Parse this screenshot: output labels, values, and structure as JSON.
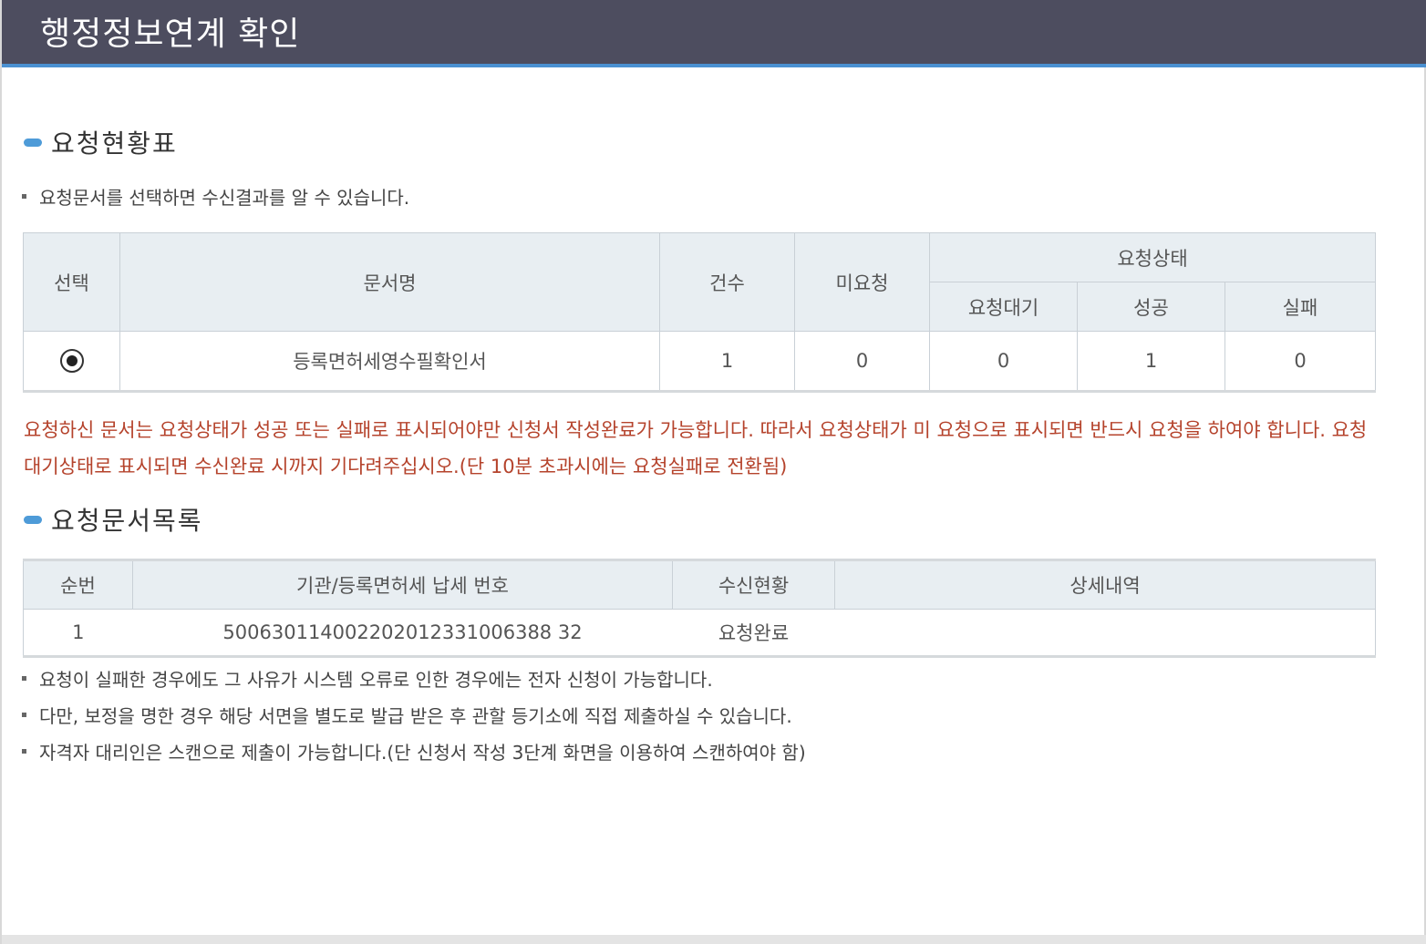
{
  "window": {
    "title": "행정정보연계 확인"
  },
  "section1": {
    "title": "요청현황표",
    "hint": "요청문서를 선택하면 수신결과를 알 수 있습니다.",
    "table": {
      "headers": {
        "select": "선택",
        "doc_name": "문서명",
        "count": "건수",
        "unrequested": "미요청",
        "status_group": "요청상태",
        "waiting": "요청대기",
        "success": "성공",
        "fail": "실패"
      },
      "row": {
        "selected": true,
        "doc_name": "등록면허세영수필확인서",
        "count": "1",
        "unrequested": "0",
        "waiting": "0",
        "success": "1",
        "fail": "0"
      }
    },
    "notice": "요청하신 문서는 요청상태가 성공 또는 실패로 표시되어야만 신청서 작성완료가 가능합니다. 따라서 요청상태가 미 요청으로 표시되면 반드시 요청을 하여야 합니다. 요청 대기상태로 표시되면 수신완료 시까지 기다려주십시오.(단 10분 초과시에는 요청실패로 전환됨)"
  },
  "section2": {
    "title": "요청문서목록",
    "table": {
      "headers": {
        "seq": "순번",
        "org_number": "기관/등록면허세 납세 번호",
        "receipt_status": "수신현황",
        "detail": "상세내역"
      },
      "rows": [
        {
          "seq": "1",
          "org_number": "500630114002202012331006388 32",
          "receipt_status": "요청완료",
          "detail": ""
        }
      ]
    },
    "notes": [
      "요청이 실패한 경우에도 그 사유가 시스템 오류로 인한 경우에는 전자 신청이 가능합니다.",
      "다만, 보정을 명한 경우 해당 서면을 별도로 발급 받은 후 관할 등기소에 직접 제출하실 수 있습니다.",
      "자격자 대리인은 스캔으로 제출이 가능합니다.(단 신청서 작성 3단계 화면을 이용하여 스캔하여야 함)"
    ]
  }
}
